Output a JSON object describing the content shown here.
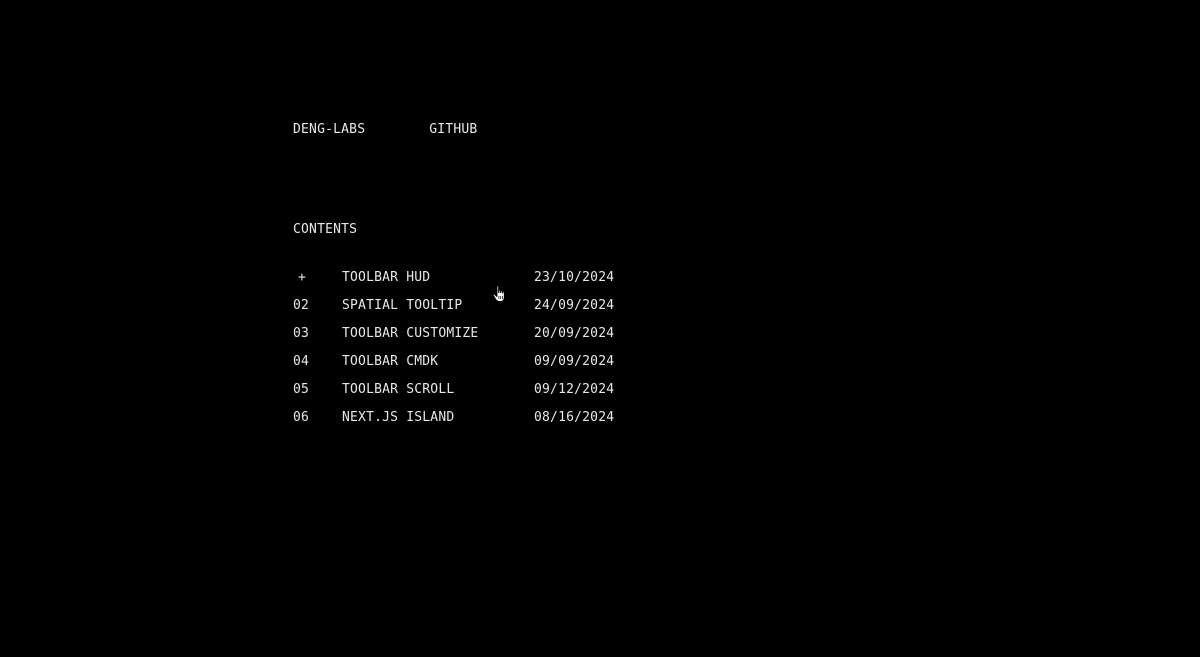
{
  "header": {
    "links": [
      {
        "label": "DENG-LABS"
      },
      {
        "label": "GITHUB"
      }
    ]
  },
  "contents": {
    "heading": "CONTENTS",
    "items": [
      {
        "num": "+",
        "title": "TOOLBAR HUD",
        "date": "23/10/2024"
      },
      {
        "num": "02",
        "title": "SPATIAL TOOLTIP",
        "date": "24/09/2024"
      },
      {
        "num": "03",
        "title": "TOOLBAR CUSTOMIZE",
        "date": "20/09/2024"
      },
      {
        "num": "04",
        "title": "TOOLBAR CMDK",
        "date": "09/09/2024"
      },
      {
        "num": "05",
        "title": "TOOLBAR SCROLL",
        "date": "09/12/2024"
      },
      {
        "num": "06",
        "title": "NEXT.JS ISLAND",
        "date": "08/16/2024"
      }
    ]
  },
  "colors": {
    "background": "#000000",
    "text": "#e8e8e8"
  },
  "icons": {
    "cursor": "hand-pointer-cursor-icon"
  }
}
